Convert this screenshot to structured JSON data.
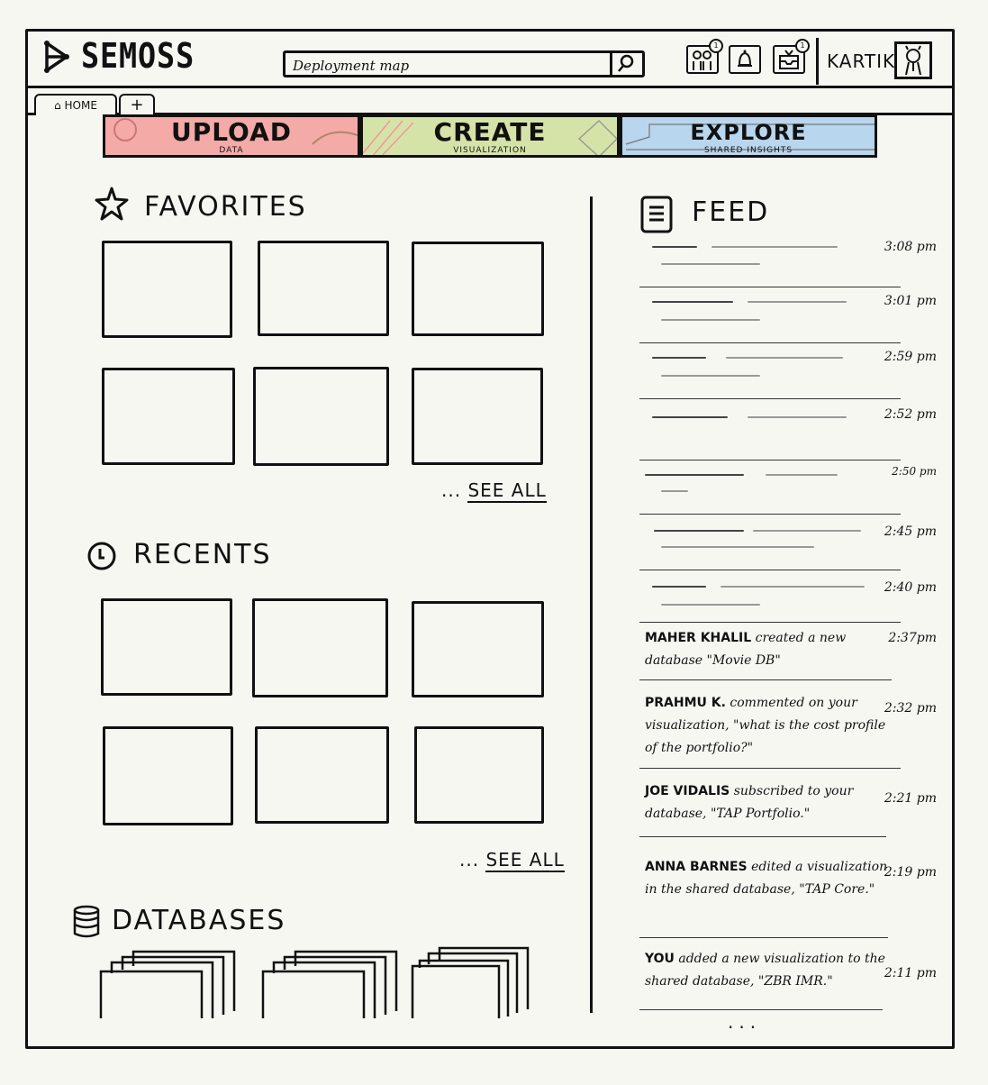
{
  "app": {
    "name": "SEMOSS"
  },
  "search": {
    "value": "Deployment map"
  },
  "header": {
    "user_name": "KARTIK",
    "icons": [
      "people-icon",
      "bell-icon",
      "inbox-icon"
    ],
    "badges": [
      "1",
      "",
      "1"
    ]
  },
  "tabs": [
    {
      "label": "HOME"
    },
    {
      "label": "+"
    }
  ],
  "hero": [
    {
      "title": "UPLOAD",
      "subtitle": "DATA",
      "color": "#f4aaa7"
    },
    {
      "title": "CREATE",
      "subtitle": "VISUALIZATION",
      "color": "#d6e3a8"
    },
    {
      "title": "EXPLORE",
      "subtitle": "SHARED INSIGHTS",
      "color": "#b8d6ee"
    }
  ],
  "favorites": {
    "title": "FAVORITES",
    "see_all": "SEE ALL",
    "ellipsis": "..."
  },
  "recents": {
    "title": "RECENTS",
    "see_all": "SEE ALL",
    "ellipsis": "..."
  },
  "databases": {
    "title": "DATABASES"
  },
  "feed": {
    "title": "FEED",
    "placeholder_times": [
      "3:08 pm",
      "3:01 pm",
      "2:59 pm",
      "2:52 pm",
      "2:50 pm",
      "2:45 pm",
      "2:40 pm"
    ],
    "items": [
      {
        "user": "MAHER KHALIL",
        "text": "created a new database \"Movie DB\"",
        "time": "2:37pm"
      },
      {
        "user": "PRAHMU K.",
        "text": "commented on your visualization, \"what is the cost profile of the portfolio?\"",
        "time": "2:32 pm"
      },
      {
        "user": "JOE VIDALIS",
        "text": "subscribed to your database, \"TAP Portfolio.\"",
        "time": "2:21 pm"
      },
      {
        "user": "ANNA BARNES",
        "text": "edited a visualization in the shared database, \"TAP Core.\"",
        "time": "2:19 pm"
      },
      {
        "user": "YOU",
        "text": "added a new visualization to the shared database, \"ZBR IMR.\"",
        "time": "2:11 pm"
      }
    ],
    "more": "..."
  }
}
